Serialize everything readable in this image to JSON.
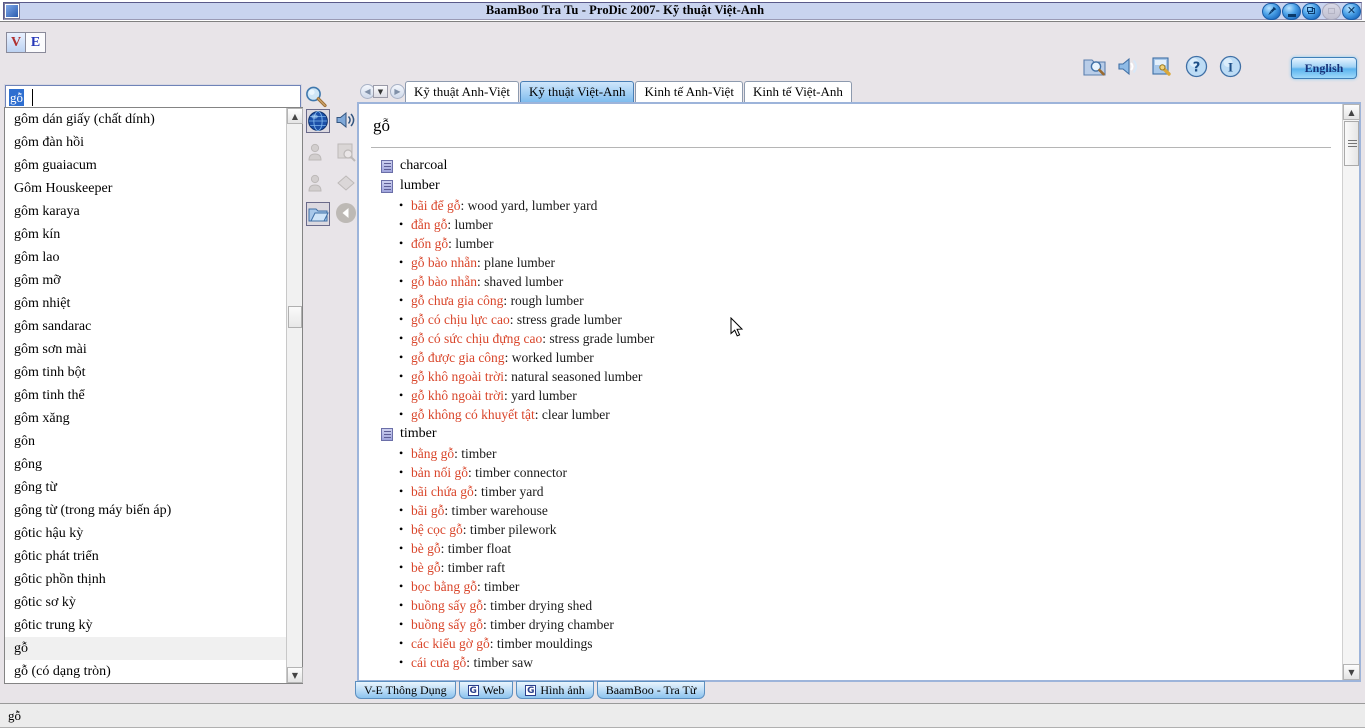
{
  "window": {
    "title": "BaamBoo Tra Tu  - ProDic 2007- Kỹ thuật Việt-Anh",
    "app_icon": "app-icon",
    "controls": [
      {
        "name": "pin-button",
        "glyph": "pin"
      },
      {
        "name": "minimize-button",
        "glyph": "minimize"
      },
      {
        "name": "restore-button",
        "glyph": "restore"
      },
      {
        "name": "maximize-button",
        "glyph": "maximize",
        "disabled": true
      },
      {
        "name": "close-button",
        "glyph": "✕"
      }
    ]
  },
  "toolbar": {
    "lang_toggle": {
      "vietnamese": "V",
      "english": "E"
    },
    "search": {
      "value": "gỗ",
      "placeholder": "",
      "icon": "magnifier-icon"
    },
    "right_icons": [
      {
        "name": "folder-search-icon",
        "title": "folder-search"
      },
      {
        "name": "speaker-icon",
        "title": "sound"
      },
      {
        "name": "settings-icon",
        "title": "settings"
      },
      {
        "name": "help-icon",
        "title": "help"
      },
      {
        "name": "info-icon",
        "title": "info"
      }
    ],
    "language_button": "English"
  },
  "wordlist": {
    "items": [
      "gôm dán giấy (chất dính)",
      "gôm đàn hồi",
      "gôm guaiacum",
      "Gôm Houskeeper",
      "gôm karaya",
      "gôm kín",
      "gôm lao",
      "gôm mỡ",
      "gôm nhiệt",
      "gôm sandarac",
      "gôm sơn mài",
      "gôm tinh bột",
      "gôm tinh thể",
      "gôm xăng",
      "gôn",
      "gông",
      "gông từ",
      "gông từ (trong máy biến áp)",
      "gôtic hậu kỳ",
      "gôtic phát triển",
      "gôtic phồn thịnh",
      "gôtic sơ kỳ",
      "gôtic trung kỳ",
      "gỗ",
      "gỗ (có dạng tròn)"
    ],
    "selected_index": 23
  },
  "side_icons": [
    {
      "name": "globe-icon",
      "enabled": true,
      "framed": true
    },
    {
      "name": "speaker-icon",
      "enabled": true,
      "framed": false
    },
    {
      "name": "person-icon",
      "enabled": false,
      "framed": false
    },
    {
      "name": "document-search-icon",
      "enabled": false,
      "framed": false
    },
    {
      "name": "person-add-icon",
      "enabled": false,
      "framed": false
    },
    {
      "name": "diamond-icon",
      "enabled": false,
      "framed": false
    },
    {
      "name": "folder-open-icon",
      "enabled": true,
      "framed": true
    },
    {
      "name": "back-arrow-icon",
      "enabled": false,
      "framed": false
    }
  ],
  "tabs": {
    "nav_prev": "◀",
    "nav_dropdown": "▼",
    "nav_next": "▶",
    "items": [
      {
        "label": "Kỹ thuật Anh-Việt",
        "active": false
      },
      {
        "label": "Kỹ thuật Việt-Anh",
        "active": true
      },
      {
        "label": "Kinh tế Anh-Việt",
        "active": false
      },
      {
        "label": "Kinh tế Việt-Anh",
        "active": false
      }
    ]
  },
  "content": {
    "headword": "gỗ",
    "groups": [
      {
        "title": "charcoal",
        "entries": []
      },
      {
        "title": "lumber",
        "entries": [
          {
            "vn": "bãi để gỗ",
            "en": "wood yard, lumber yard"
          },
          {
            "vn": "đẵn gỗ",
            "en": "lumber"
          },
          {
            "vn": "đốn gỗ",
            "en": "lumber"
          },
          {
            "vn": "gỗ bào nhẵn",
            "en": "plane lumber"
          },
          {
            "vn": "gỗ bào nhẵn",
            "en": "shaved lumber"
          },
          {
            "vn": "gỗ chưa gia công",
            "en": "rough lumber"
          },
          {
            "vn": "gỗ có chịu lực cao",
            "en": "stress grade lumber"
          },
          {
            "vn": "gỗ có sức chịu đựng cao",
            "en": "stress grade lumber"
          },
          {
            "vn": "gỗ được gia công",
            "en": "worked lumber"
          },
          {
            "vn": "gỗ khô ngoài trời",
            "en": "natural seasoned lumber"
          },
          {
            "vn": "gỗ khô ngoài trời",
            "en": "yard lumber"
          },
          {
            "vn": "gỗ không có khuyết tật",
            "en": "clear lumber"
          }
        ]
      },
      {
        "title": "timber",
        "entries": [
          {
            "vn": "bằng gỗ",
            "en": "timber"
          },
          {
            "vn": "bản nối gỗ",
            "en": "timber connector"
          },
          {
            "vn": "bãi chứa gỗ",
            "en": "timber yard"
          },
          {
            "vn": "bãi gỗ",
            "en": "timber warehouse"
          },
          {
            "vn": "bệ cọc gỗ",
            "en": "timber pilework"
          },
          {
            "vn": "bè gỗ",
            "en": "timber float"
          },
          {
            "vn": "bè gỗ",
            "en": "timber raft"
          },
          {
            "vn": "bọc bằng gỗ",
            "en": "timber"
          },
          {
            "vn": "buồng sấy gỗ",
            "en": "timber drying shed"
          },
          {
            "vn": "buồng sấy gỗ",
            "en": "timber drying chamber"
          },
          {
            "vn": "các kiểu gờ gỗ",
            "en": "timber mouldings"
          },
          {
            "vn": "cái cưa gỗ",
            "en": "timber saw"
          }
        ]
      }
    ]
  },
  "bottom_tabs": [
    {
      "label": "V-E Thông Dụng",
      "icon": null
    },
    {
      "label": "Web",
      "icon": "G"
    },
    {
      "label": "Hình ảnh",
      "icon": "G"
    },
    {
      "label": "BaamBoo - Tra Từ",
      "icon": null
    }
  ],
  "statusbar": {
    "text": "gỗ"
  },
  "colors": {
    "vietnamese_term": "#d9452a",
    "english_term": "#1a1a1a",
    "title_bar": "#c9d4ef",
    "active_tab": "#a8d2f5",
    "window_bg": "#e8e4e8"
  }
}
